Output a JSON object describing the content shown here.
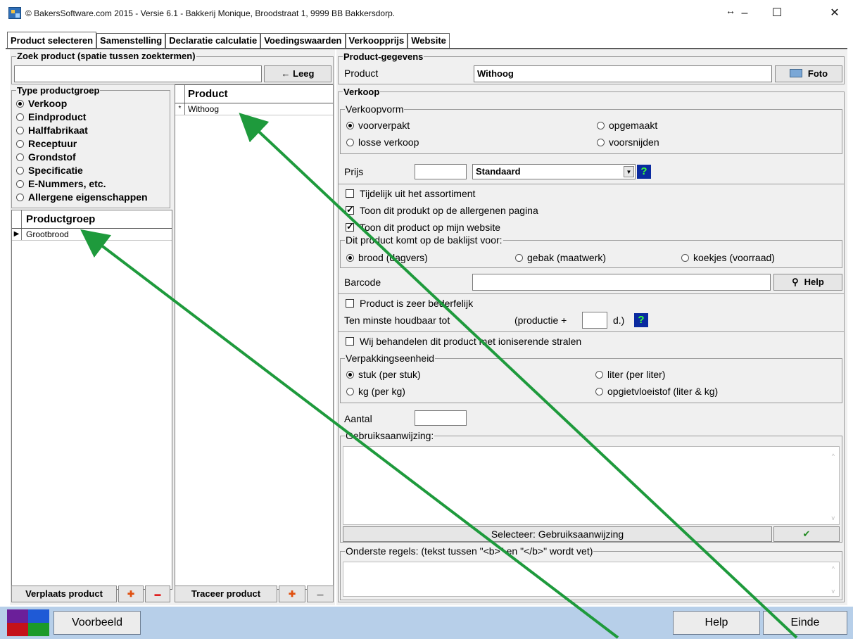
{
  "window": {
    "title": "© BakersSoftware.com 2015 - Versie 6.1 - Bakkerij Monique, Broodstraat 1, 9999 BB Bakkersdorp.",
    "resize_glyph": "↔",
    "minimize_glyph": "–",
    "maximize_glyph": "☐",
    "close_glyph": "✕"
  },
  "tabs": [
    "Product selecteren",
    "Samenstelling",
    "Declaratie calculatie",
    "Voedingswaarden",
    "Verkoopprijs",
    "Website"
  ],
  "search": {
    "legend": "Zoek product (spatie tussen zoektermen)",
    "value": "",
    "clear_label": "← Leeg"
  },
  "type_group": {
    "legend": "Type productgroep",
    "options": [
      "Verkoop",
      "Eindproduct",
      "Halffabrikaat",
      "Receptuur",
      "Grondstof",
      "Specificatie",
      "E-Nummers, etc.",
      "Allergene eigenschappen"
    ],
    "selected": "Verkoop"
  },
  "productgroup_grid": {
    "header": "Productgroep",
    "rows": [
      "Grootbrood"
    ]
  },
  "product_grid": {
    "header": "Product",
    "rows": [
      "Withoog"
    ]
  },
  "left_actions": {
    "move_label": "Verplaats product",
    "trace_label": "Traceer product",
    "plus": "✚",
    "minus": "▬"
  },
  "product_info": {
    "legend": "Product-gegevens",
    "product_label": "Product",
    "product_value": "Withoog",
    "photo_label": "Foto"
  },
  "sales": {
    "legend": "Verkoop",
    "form_legend": "Verkoopvorm",
    "forms": [
      "voorverpakt",
      "opgemaakt",
      "losse verkoop",
      "voorsnijden"
    ],
    "form_selected": "voorverpakt",
    "price_label": "Prijs",
    "price_value": "",
    "price_type": "Standaard",
    "temp_out": "Tijdelijk uit het assortiment",
    "allergen_page": "Toon dit produkt op de allergenen pagina",
    "website": "Toon dit product op mijn website",
    "baklist_legend": "Dit product komt op de baklijst voor:",
    "baklist": [
      "brood (dagvers)",
      "gebak (maatwerk)",
      "koekjes (voorraad)"
    ],
    "baklist_selected": "brood (dagvers)",
    "barcode_label": "Barcode",
    "barcode_value": "",
    "help_label": "Help",
    "perishable": "Product is zeer bederfelijk",
    "shelf_label": "Ten minste houdbaar tot",
    "shelf_prefix": "(productie +",
    "shelf_value": "",
    "shelf_suffix": "d.)",
    "ionizing": "Wij behandelen dit product met ioniserende stralen",
    "packaging_legend": "Verpakkingseenheid",
    "packaging": [
      "stuk (per stuk)",
      "liter (per liter)",
      "kg (per kg)",
      "opgietvloeistof (liter & kg)"
    ],
    "packaging_selected": "stuk (per stuk)",
    "count_label": "Aantal",
    "count_value": "",
    "usage_legend": "Gebruiksaanwijzing:",
    "usage_select": "Selecteer: Gebruiksaanwijzing",
    "usage_ok": "✔",
    "bottom_rules_legend": "Onderste regels: (tekst tussen \"<b>\" en \"</b>\" wordt vet)"
  },
  "footer": {
    "preview_label": "Voorbeeld",
    "help_label": "Help",
    "end_label": "Einde"
  },
  "colors": {
    "bottom_bar": "#b7cfe9",
    "arrow": "#1e9a3c",
    "help_bg": "#0a2aa0",
    "help_fg": "#38ff3a"
  }
}
